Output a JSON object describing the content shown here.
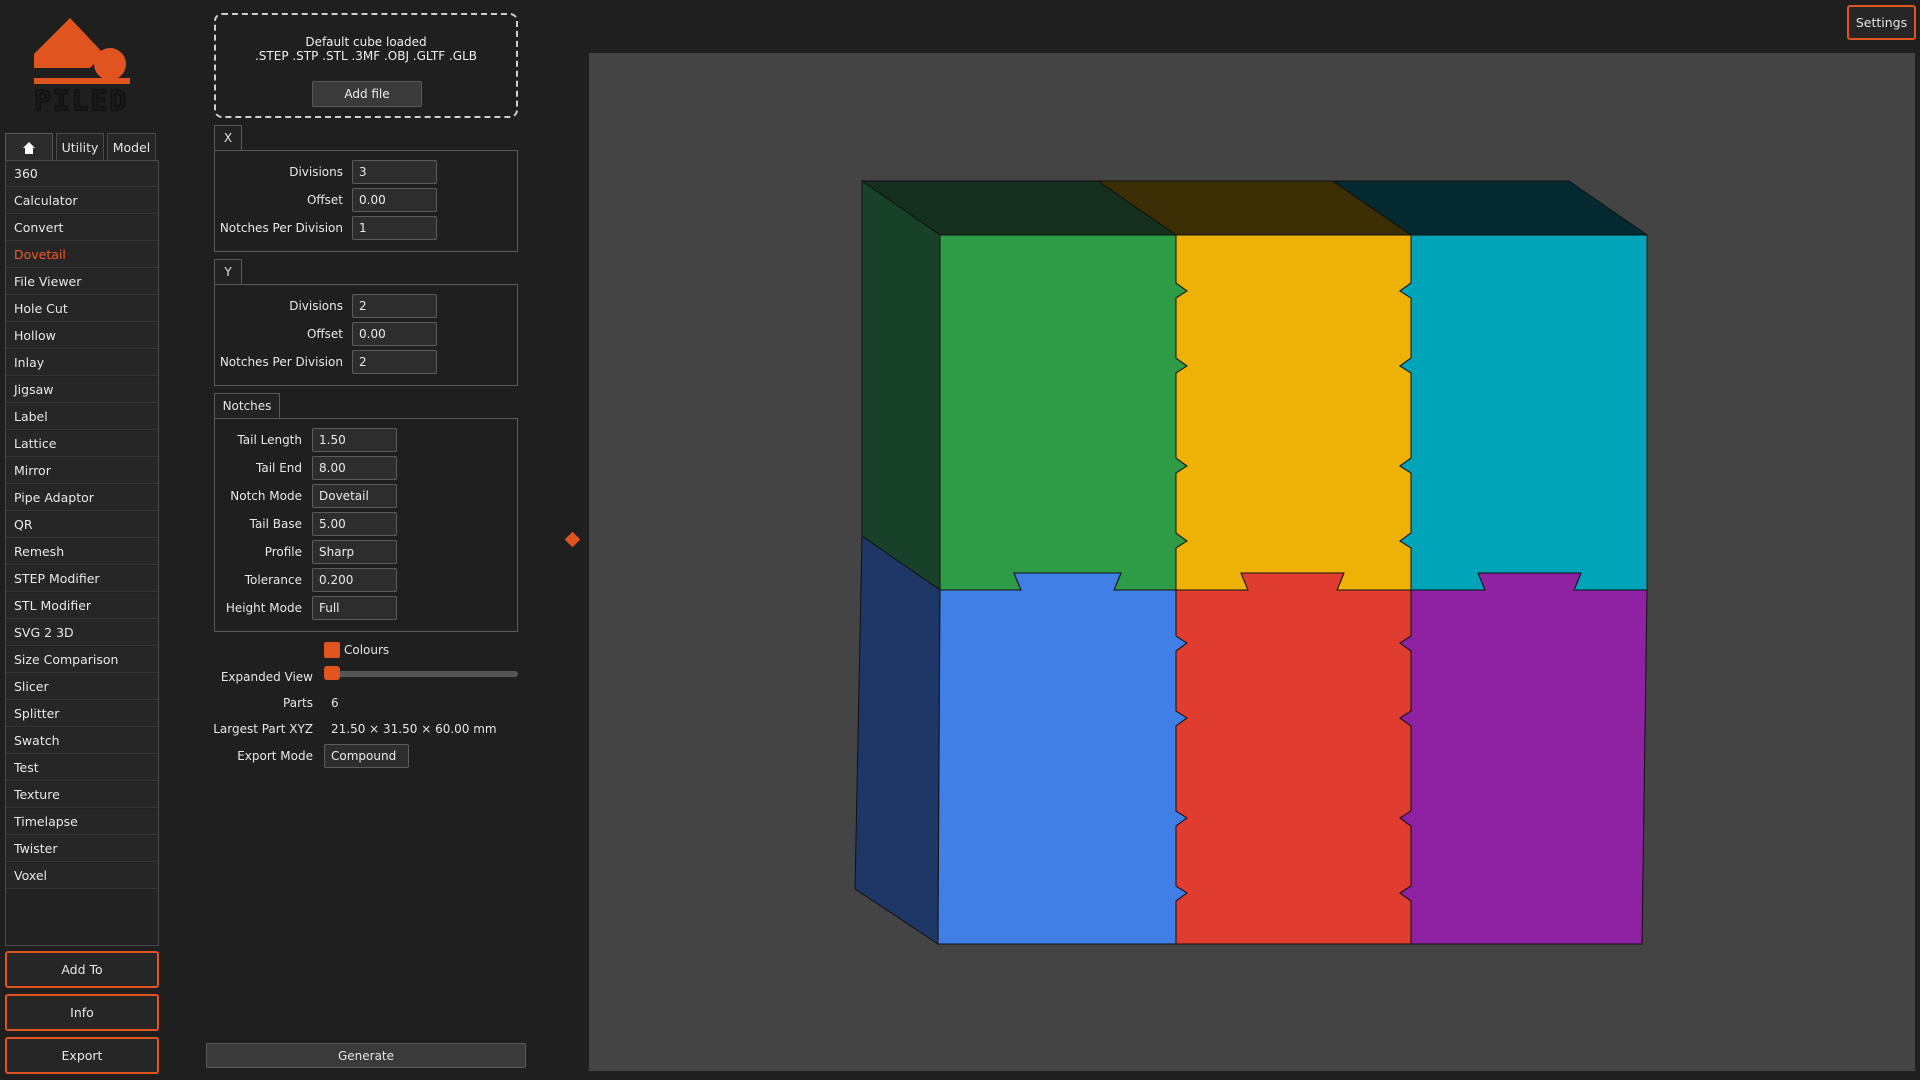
{
  "logo": {
    "text": "PILED",
    "brand_color": "#e0551f"
  },
  "tabs": [
    {
      "icon": "home-icon"
    },
    {
      "label": "Utility"
    },
    {
      "label": "Model"
    }
  ],
  "tools": [
    "360",
    "Calculator",
    "Convert",
    "Dovetail",
    "File Viewer",
    "Hole Cut",
    "Hollow",
    "Inlay",
    "Jigsaw",
    "Label",
    "Lattice",
    "Mirror",
    "Pipe Adaptor",
    "QR",
    "Remesh",
    "STEP Modifier",
    "STL Modifier",
    "SVG 2 3D",
    "Size Comparison",
    "Slicer",
    "Splitter",
    "Swatch",
    "Test",
    "Texture",
    "Timelapse",
    "Twister",
    "Voxel"
  ],
  "selected_tool": "Dovetail",
  "side_buttons": {
    "add_to": "Add To",
    "info": "Info",
    "export": "Export"
  },
  "dropzone": {
    "status": "Default cube loaded",
    "formats": ".STEP .STP .STL .3MF .OBJ .GLTF .GLB",
    "add_file": "Add file"
  },
  "x_group": {
    "title": "X",
    "divisions_label": "Divisions",
    "divisions": "3",
    "offset_label": "Offset",
    "offset": "0.00",
    "notches_label": "Notches Per Division",
    "notches": "1"
  },
  "y_group": {
    "title": "Y",
    "divisions_label": "Divisions",
    "divisions": "2",
    "offset_label": "Offset",
    "offset": "0.00",
    "notches_label": "Notches Per Division",
    "notches": "2"
  },
  "notches_group": {
    "title": "Notches",
    "tail_length_label": "Tail Length",
    "tail_length": "1.50",
    "tail_end_label": "Tail End",
    "tail_end": "8.00",
    "notch_mode_label": "Notch Mode",
    "notch_mode": "Dovetail",
    "tail_base_label": "Tail Base",
    "tail_base": "5.00",
    "profile_label": "Profile",
    "profile": "Sharp",
    "tolerance_label": "Tolerance",
    "tolerance": "0.200",
    "height_mode_label": "Height Mode",
    "height_mode": "Full"
  },
  "options": {
    "colours_label": "Colours",
    "colours_checked": true,
    "expanded_view_label": "Expanded View",
    "expanded_view_value": 0,
    "parts_label": "Parts",
    "parts": "6",
    "largest_part_label": "Largest Part XYZ",
    "largest_part": "21.50 × 31.50 × 60.00 mm",
    "export_mode_label": "Export Mode",
    "export_mode": "Compound"
  },
  "generate": "Generate",
  "settings": "Settings",
  "part_colors": {
    "green": "#2e9b47",
    "yellow": "#eeb106",
    "cyan": "#00a4b8",
    "blue": "#3f7fe6",
    "red": "#e03c2f",
    "purple": "#8e22a3"
  }
}
